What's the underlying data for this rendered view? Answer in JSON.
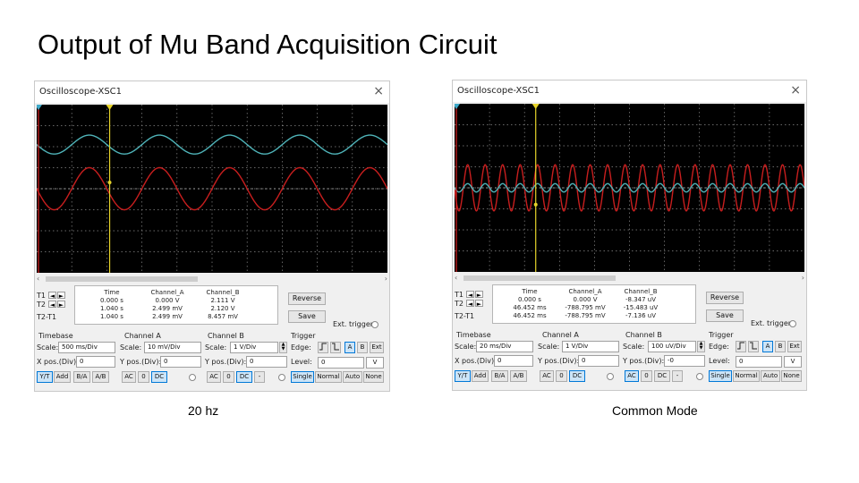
{
  "slide": {
    "title": "Output of Mu Band Acquisition Circuit"
  },
  "captions": {
    "left": "20 hz",
    "right": "Common Mode"
  },
  "colors": {
    "screen_bg": "#000000",
    "channel_a": "#4fb3b8",
    "channel_b": "#c81e1e",
    "cursor_t1": "#d81f1f",
    "cursor_t2": "#e6d32a",
    "grid": "#8a8a8a",
    "button_selected": "#cce4f7"
  },
  "scopes": [
    {
      "window_title": "Oscilloscope-XSC1",
      "close_icon": "×",
      "scroll": {
        "left_arrow": "‹",
        "right_arrow": "›"
      },
      "cursor_labels": {
        "t1": "T1",
        "t2": "T2",
        "t2t1": "T2-T1"
      },
      "cursor_arrows": {
        "left": "◄",
        "right": "►"
      },
      "readout": {
        "headers": [
          "Time",
          "Channel_A",
          "Channel_B"
        ],
        "rows": [
          [
            "0.000 s",
            "0.000 V",
            "2.111 V"
          ],
          [
            "1.040 s",
            "2.499 mV",
            "2.120 V"
          ],
          [
            "1.040 s",
            "2.499 mV",
            "8.457 mV"
          ]
        ]
      },
      "buttons": {
        "reverse": "Reverse",
        "save": "Save"
      },
      "ext_trigger": "Ext. trigger",
      "timebase": {
        "label": "Timebase",
        "scale_label": "Scale:",
        "scale": "500 ms/Div",
        "xpos_label": "X pos.(Div):",
        "xpos": "0",
        "modes": [
          "Y/T",
          "Add",
          "B/A",
          "A/B"
        ],
        "selected_mode": "Y/T"
      },
      "channel_a": {
        "label": "Channel A",
        "scale_label": "Scale:",
        "scale": "10 mV/Div",
        "ypos_label": "Y pos.(Div):",
        "ypos": "0",
        "coupling": [
          "AC",
          "0",
          "DC"
        ],
        "selected": "DC"
      },
      "channel_b": {
        "label": "Channel B",
        "scale_label": "Scale:",
        "scale": "1  V/Div",
        "ypos_label": "Y pos.(Div):",
        "ypos": "0",
        "coupling": [
          "AC",
          "0",
          "DC",
          "-"
        ],
        "selected": "DC"
      },
      "trigger": {
        "label": "Trigger",
        "edge_label": "Edge:",
        "edge_rise_icon": "rising-edge-icon",
        "edge_fall_icon": "falling-edge-icon",
        "sources": [
          "A",
          "B",
          "Ext"
        ],
        "selected_source": "A",
        "level_label": "Level:",
        "level": "0",
        "level_unit": "V",
        "modes": [
          "Single",
          "Normal",
          "Auto",
          "None"
        ],
        "selected_mode": "Single"
      },
      "waves": {
        "a": {
          "cycles": 5,
          "amp_div": 0.45,
          "offset_div": 2.1
        },
        "b": {
          "cycles": 5,
          "amp_div": 1.0,
          "offset_div": 0
        },
        "t1_div": 0,
        "t2_div": 2.08,
        "marker_div": 0.3
      }
    },
    {
      "window_title": "Oscilloscope-XSC1",
      "close_icon": "×",
      "scroll": {
        "left_arrow": "‹",
        "right_arrow": "›"
      },
      "cursor_labels": {
        "t1": "T1",
        "t2": "T2",
        "t2t1": "T2-T1"
      },
      "cursor_arrows": {
        "left": "◄",
        "right": "►"
      },
      "readout": {
        "headers": [
          "Time",
          "Channel_A",
          "Channel_B"
        ],
        "rows": [
          [
            "0.000 s",
            "0.000 V",
            "-8.347 uV"
          ],
          [
            "46.452 ms",
            "-788.795 mV",
            "-15.483 uV"
          ],
          [
            "46.452 ms",
            "-788.795 mV",
            "-7.136 uV"
          ]
        ]
      },
      "buttons": {
        "reverse": "Reverse",
        "save": "Save"
      },
      "ext_trigger": "Ext. trigger",
      "timebase": {
        "label": "Timebase",
        "scale_label": "Scale:",
        "scale": "20 ms/Div",
        "xpos_label": "X pos.(Div):",
        "xpos": "0",
        "modes": [
          "Y/T",
          "Add",
          "B/A",
          "A/B"
        ],
        "selected_mode": "Y/T"
      },
      "channel_a": {
        "label": "Channel A",
        "scale_label": "Scale:",
        "scale": "1  V/Div",
        "ypos_label": "Y pos.(Div):",
        "ypos": "0",
        "coupling": [
          "AC",
          "0",
          "DC"
        ],
        "selected": "DC"
      },
      "channel_b": {
        "label": "Channel B",
        "scale_label": "Scale:",
        "scale": "100 uV/Div",
        "ypos_label": "Y pos.(Div):",
        "ypos": "-0",
        "coupling": [
          "AC",
          "0",
          "DC",
          "-"
        ],
        "selected": "AC"
      },
      "trigger": {
        "label": "Trigger",
        "edge_label": "Edge:",
        "edge_rise_icon": "rising-edge-icon",
        "edge_fall_icon": "falling-edge-icon",
        "sources": [
          "A",
          "B",
          "Ext"
        ],
        "selected_source": "A",
        "level_label": "Level:",
        "level": "0",
        "level_unit": "V",
        "modes": [
          "Single",
          "Normal",
          "Auto",
          "None"
        ],
        "selected_mode": "Single"
      },
      "waves": {
        "a": {
          "cycles": 20,
          "amp_div": 0.2,
          "offset_div": 0
        },
        "b": {
          "cycles": 20,
          "amp_div": 1.1,
          "offset_div": 0
        },
        "t1_div": 0,
        "t2_div": 2.32,
        "marker_div": -0.8
      }
    }
  ]
}
